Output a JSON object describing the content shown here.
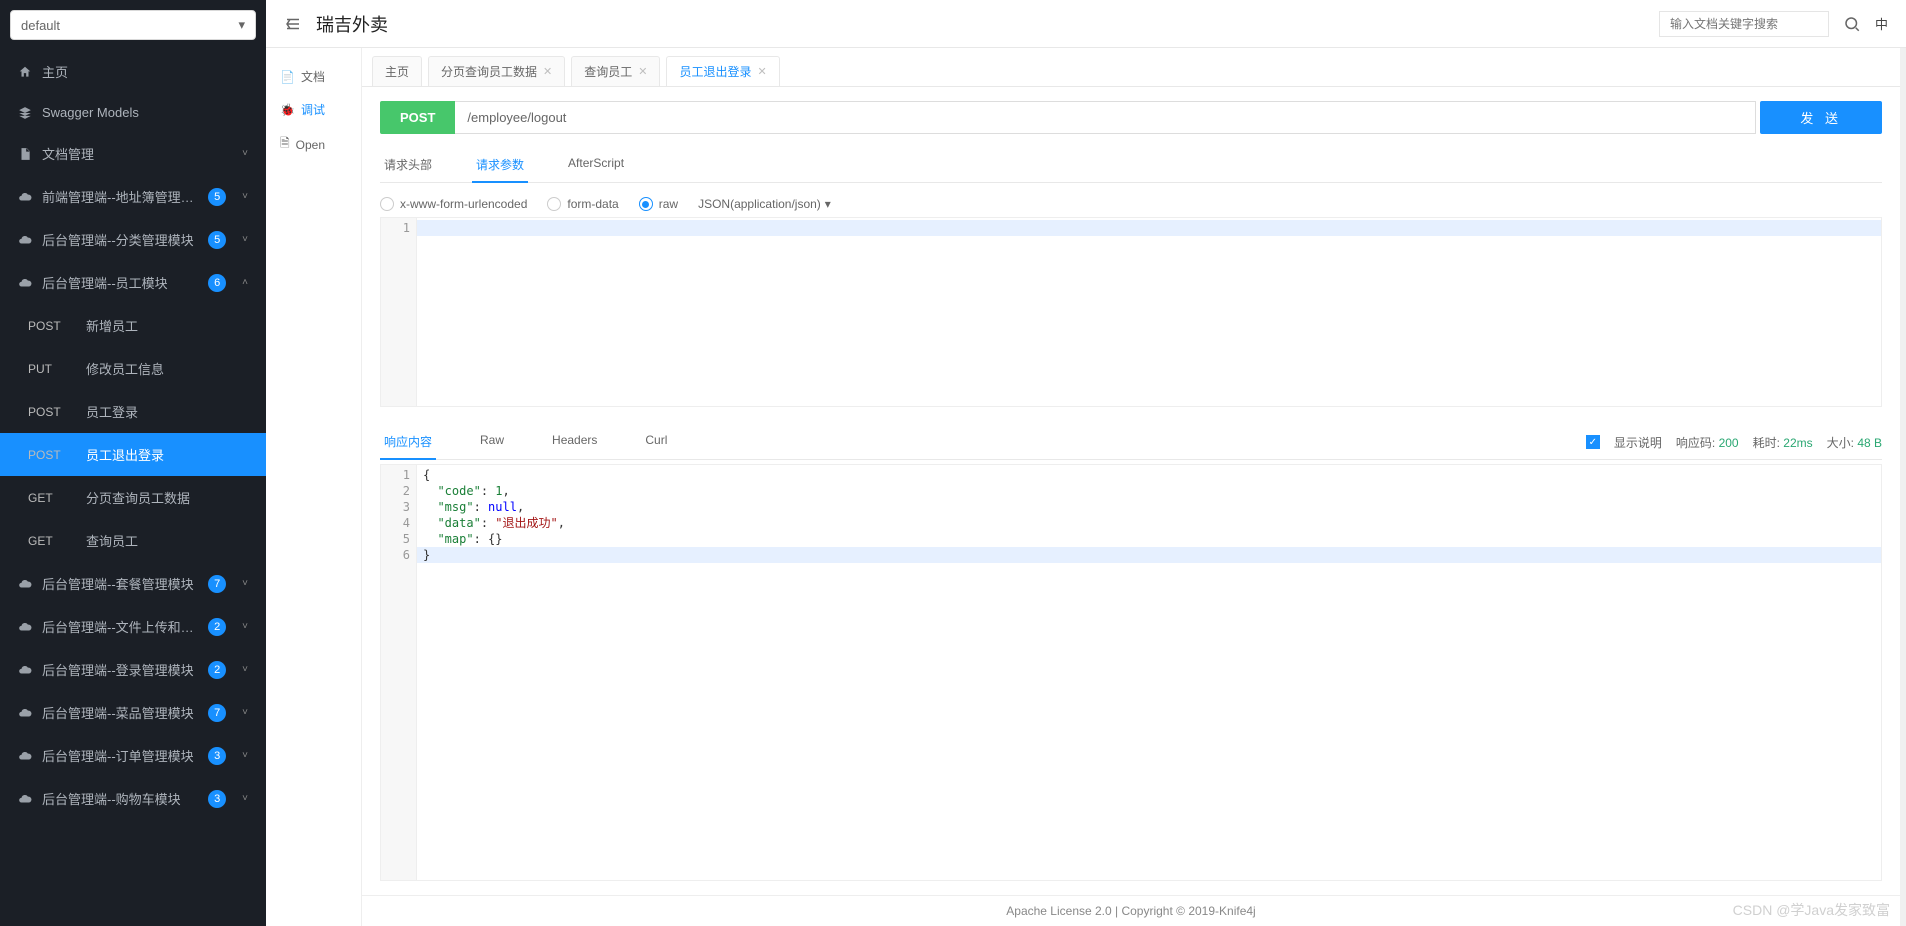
{
  "project": {
    "name": "default"
  },
  "sidebar": {
    "items": [
      {
        "label": "主页",
        "icon": "home"
      },
      {
        "label": "Swagger Models",
        "icon": "layers"
      },
      {
        "label": "文档管理",
        "icon": "doc",
        "chevron": "down"
      },
      {
        "label": "前端管理端--地址簿管理模块",
        "icon": "cloud",
        "badge": "5",
        "chevron": "down"
      },
      {
        "label": "后台管理端--分类管理模块",
        "icon": "cloud",
        "badge": "5",
        "chevron": "down"
      },
      {
        "label": "后台管理端--员工模块",
        "icon": "cloud",
        "badge": "6",
        "chevron": "up"
      },
      {
        "label": "后台管理端--套餐管理模块",
        "icon": "cloud",
        "badge": "7",
        "chevron": "down"
      },
      {
        "label": "后台管理端--文件上传和下载模块",
        "icon": "cloud",
        "badge": "2",
        "chevron": "down"
      },
      {
        "label": "后台管理端--登录管理模块",
        "icon": "cloud",
        "badge": "2",
        "chevron": "down"
      },
      {
        "label": "后台管理端--菜品管理模块",
        "icon": "cloud",
        "badge": "7",
        "chevron": "down"
      },
      {
        "label": "后台管理端--订单管理模块",
        "icon": "cloud",
        "badge": "3",
        "chevron": "down"
      },
      {
        "label": "后台管理端--购物车模块",
        "icon": "cloud",
        "badge": "3",
        "chevron": "down"
      }
    ],
    "apiChildren": [
      {
        "method": "POST",
        "label": "新增员工"
      },
      {
        "method": "PUT",
        "label": "修改员工信息"
      },
      {
        "method": "POST",
        "label": "员工登录"
      },
      {
        "method": "POST",
        "label": "员工退出登录",
        "active": true
      },
      {
        "method": "GET",
        "label": "分页查询员工数据"
      },
      {
        "method": "GET",
        "label": "查询员工"
      }
    ]
  },
  "header": {
    "title": "瑞吉外卖",
    "searchPlaceholder": "输入文档关键字搜索",
    "langBadge": "中"
  },
  "subnav": {
    "doc": "文档",
    "debug": "调试",
    "open": "Open"
  },
  "tabs": [
    {
      "label": "主页"
    },
    {
      "label": "分页查询员工数据",
      "closable": true
    },
    {
      "label": "查询员工",
      "closable": true
    },
    {
      "label": "员工退出登录",
      "closable": true,
      "active": true
    }
  ],
  "request": {
    "method": "POST",
    "url": "/employee/logout",
    "sendLabel": "发 送"
  },
  "reqTabs": {
    "headers": "请求头部",
    "params": "请求参数",
    "afterScript": "AfterScript"
  },
  "bodyTypes": {
    "form": "x-www-form-urlencoded",
    "formData": "form-data",
    "raw": "raw",
    "jsonSel": "JSON(application/json)"
  },
  "respTabs": {
    "body": "响应内容",
    "raw": "Raw",
    "headers": "Headers",
    "curl": "Curl"
  },
  "respMeta": {
    "showDesc": "显示说明",
    "statusLabel": "响应码:",
    "status": "200",
    "timeLabel": "耗时:",
    "time": "22ms",
    "sizeLabel": "大小:",
    "size": "48 B"
  },
  "responseBody": {
    "code": 1,
    "msg": null,
    "data": "退出成功",
    "map": {}
  },
  "footer": {
    "text": "Apache License 2.0 | Copyright © 2019-Knife4j"
  },
  "watermark": "CSDN @学Java发家致富"
}
